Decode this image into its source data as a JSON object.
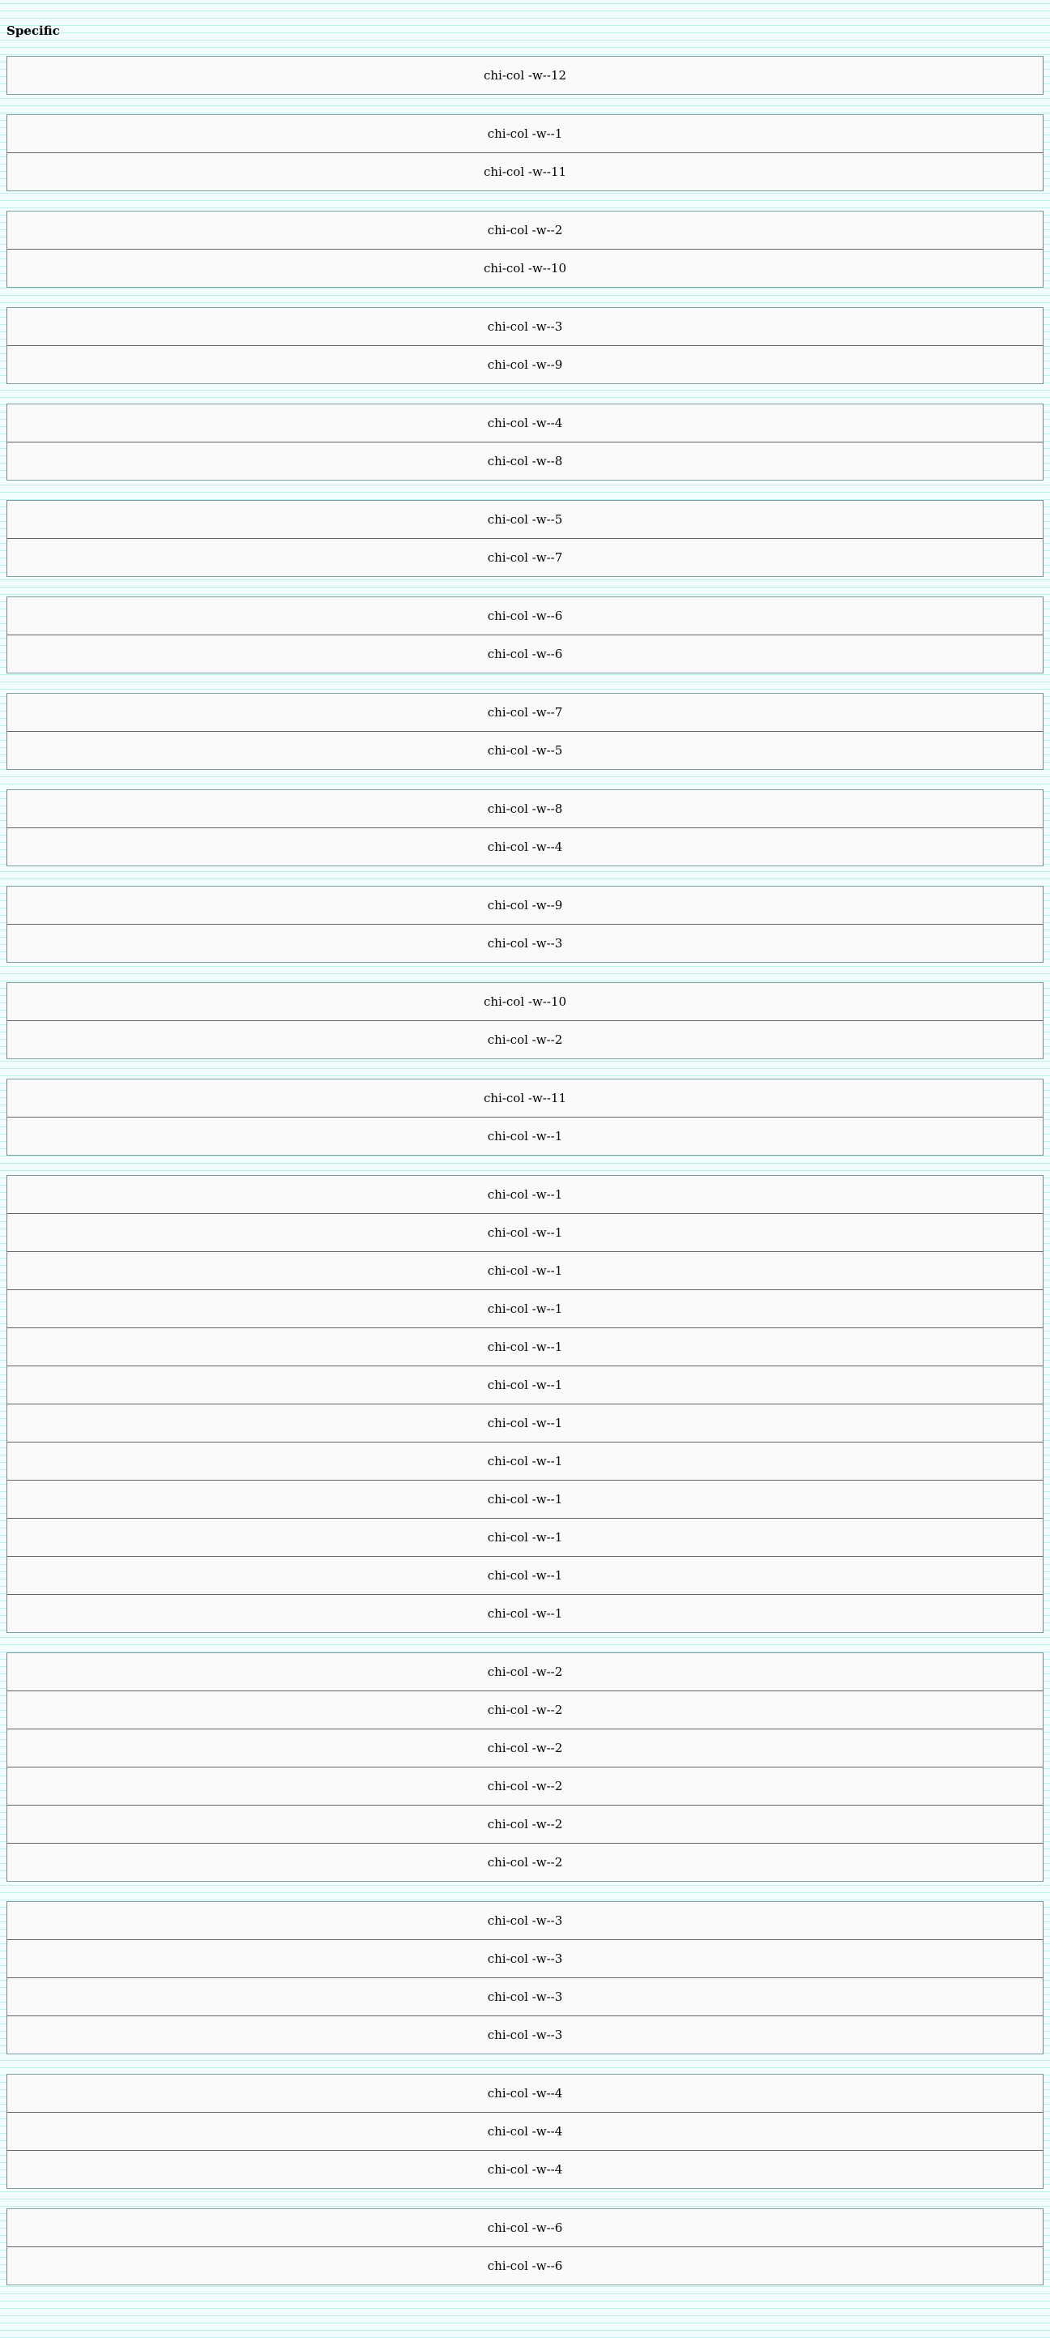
{
  "section_title": "Specific",
  "groups": [
    [
      "chi-col -w--12"
    ],
    [
      "chi-col -w--1",
      "chi-col -w--11"
    ],
    [
      "chi-col -w--2",
      "chi-col -w--10"
    ],
    [
      "chi-col -w--3",
      "chi-col -w--9"
    ],
    [
      "chi-col -w--4",
      "chi-col -w--8"
    ],
    [
      "chi-col -w--5",
      "chi-col -w--7"
    ],
    [
      "chi-col -w--6",
      "chi-col -w--6"
    ],
    [
      "chi-col -w--7",
      "chi-col -w--5"
    ],
    [
      "chi-col -w--8",
      "chi-col -w--4"
    ],
    [
      "chi-col -w--9",
      "chi-col -w--3"
    ],
    [
      "chi-col -w--10",
      "chi-col -w--2"
    ],
    [
      "chi-col -w--11",
      "chi-col -w--1"
    ],
    [
      "chi-col -w--1",
      "chi-col -w--1",
      "chi-col -w--1",
      "chi-col -w--1",
      "chi-col -w--1",
      "chi-col -w--1",
      "chi-col -w--1",
      "chi-col -w--1",
      "chi-col -w--1",
      "chi-col -w--1",
      "chi-col -w--1",
      "chi-col -w--1"
    ],
    [
      "chi-col -w--2",
      "chi-col -w--2",
      "chi-col -w--2",
      "chi-col -w--2",
      "chi-col -w--2",
      "chi-col -w--2"
    ],
    [
      "chi-col -w--3",
      "chi-col -w--3",
      "chi-col -w--3",
      "chi-col -w--3"
    ],
    [
      "chi-col -w--4",
      "chi-col -w--4",
      "chi-col -w--4"
    ],
    [
      "chi-col -w--6",
      "chi-col -w--6"
    ]
  ]
}
